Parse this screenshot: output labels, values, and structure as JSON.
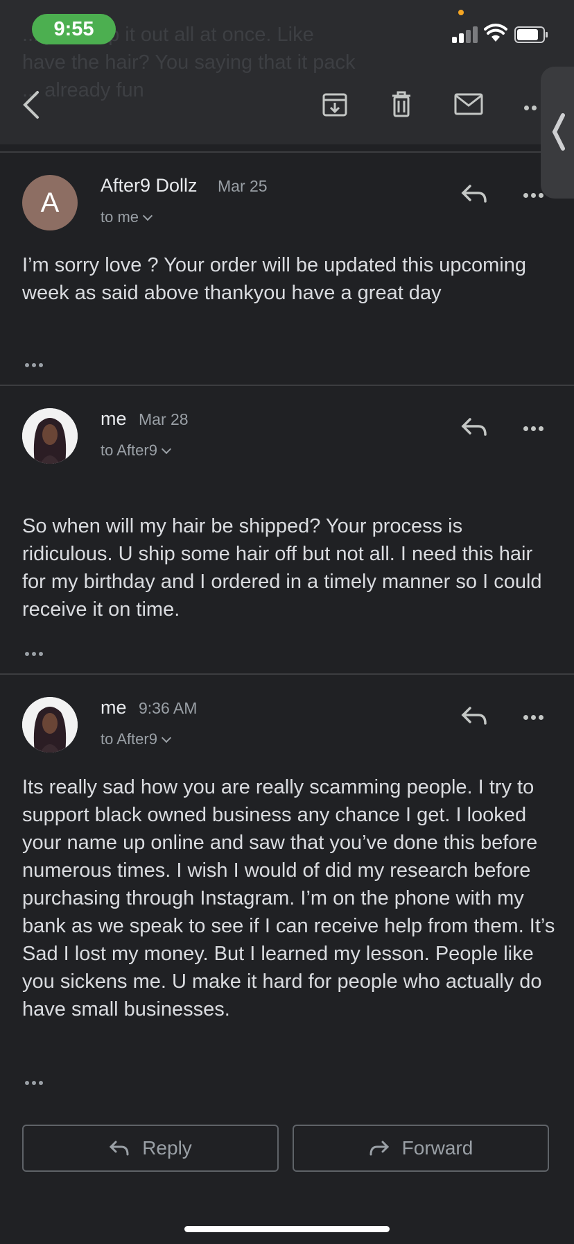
{
  "status_bar": {
    "time": "9:55"
  },
  "header": {
    "ghost_lines": [
      "... you ship it out all at once. Like",
      "have the hair? You saying that it pack",
      "... already fun"
    ],
    "icons": [
      "back-arrow-icon",
      "archive-icon",
      "trash-icon",
      "mail-icon",
      "more-icon"
    ]
  },
  "messages": [
    {
      "avatar_letter": "A",
      "sender": "After9 Dollz",
      "date": "Mar 25",
      "to": "to me",
      "body": "I’m sorry love ? Your order will be updated this upcoming week as said above thankyou have a great day"
    },
    {
      "sender": "me",
      "date": "Mar 28",
      "to": "to After9",
      "body": "So when will my hair be shipped? Your process is ridiculous. U ship some hair off but not all. I need this hair for my birthday and I ordered in a timely manner so I could receive it on time."
    },
    {
      "sender": "me",
      "date": "9:36 AM",
      "to": "to After9",
      "body": "Its really sad how you are really scamming people. I try to support black owned business any chance I get. I looked your name up online and saw that you’ve done this before numerous times. I wish I would of did my research before purchasing through Instagram. I’m on the phone with my bank as we speak to see if I can receive help from them. It’s  Sad I lost my money. But I learned my lesson. People like you sickens me. U make it hard for people who actually do have small businesses."
    }
  ],
  "actions": {
    "reply_label": "Reply",
    "forward_label": "Forward"
  },
  "colors": {
    "background": "#202124",
    "status_pill": "#4caf50",
    "avatar_a": "#8d6e63"
  }
}
